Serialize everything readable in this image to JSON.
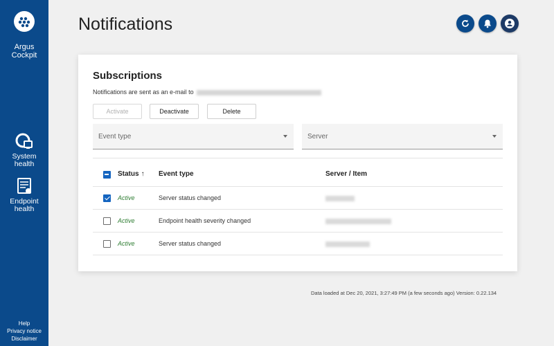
{
  "sidebar": {
    "brand_line1": "Argus",
    "brand_line2": "Cockpit",
    "items": [
      {
        "line1": "System",
        "line2": "health"
      },
      {
        "line1": "Endpoint",
        "line2": "health"
      }
    ],
    "footer": [
      "Help",
      "Privacy notice",
      "Disclaimer"
    ]
  },
  "header": {
    "title": "Notifications"
  },
  "card": {
    "title": "Subscriptions",
    "notice": "Notifications are sent as an e-mail to",
    "buttons": {
      "activate": "Activate",
      "deactivate": "Deactivate",
      "delete": "Delete"
    },
    "filters": {
      "event_type": "Event type",
      "server": "Server"
    },
    "table": {
      "headers": {
        "status": "Status",
        "event_type": "Event type",
        "server_item": "Server / Item"
      },
      "sort_icon": "↑",
      "rows": [
        {
          "checked": true,
          "status": "Active",
          "event_type": "Server status changed"
        },
        {
          "checked": false,
          "status": "Active",
          "event_type": "Endpoint health severity changed"
        },
        {
          "checked": false,
          "status": "Active",
          "event_type": "Server status changed"
        }
      ]
    }
  },
  "footer_info": "Data loaded at Dec 20, 2021, 3:27:49 PM (a few seconds ago)   Version: 0.22.134",
  "colors": {
    "sidebar": "#0b4a8b",
    "primary": "#1565c0",
    "active_status": "#2e7d32"
  },
  "icons": {
    "top_actions": [
      "refresh-icon",
      "bell-icon",
      "account-icon"
    ],
    "sidebar": [
      "system-health-icon",
      "endpoint-health-icon"
    ]
  }
}
